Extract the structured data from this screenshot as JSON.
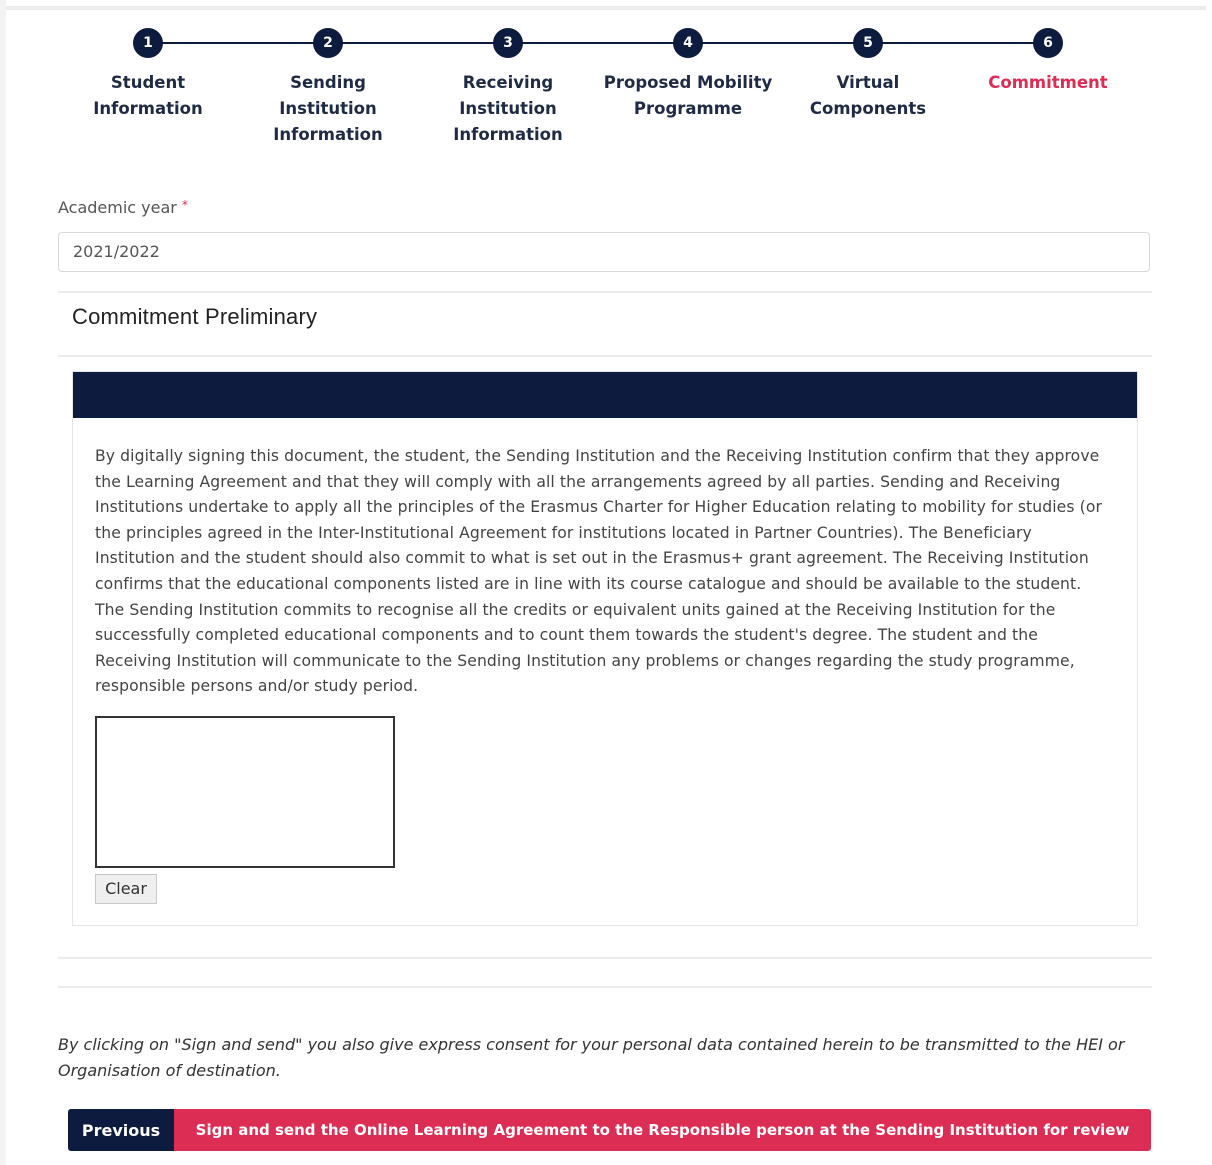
{
  "stepper": {
    "steps": [
      {
        "number": "1",
        "label": "Student Information"
      },
      {
        "number": "2",
        "label": "Sending Institution Information"
      },
      {
        "number": "3",
        "label": "Receiving Institution Information"
      },
      {
        "number": "4",
        "label": "Proposed Mobility Programme"
      },
      {
        "number": "5",
        "label": "Virtual Components"
      },
      {
        "number": "6",
        "label": "Commitment"
      }
    ],
    "active_step": 6
  },
  "academic_year": {
    "label": "Academic year",
    "required_mark": "*",
    "value": "2021/2022"
  },
  "section": {
    "title": "Commitment Preliminary"
  },
  "commitment": {
    "text": "By digitally signing this document, the student, the Sending Institution and the Receiving Institution confirm that they approve the Learning Agreement and that they will comply with all the arrangements agreed by all parties. Sending and Receiving Institutions undertake to apply all the principles of the Erasmus Charter for Higher Education relating to mobility for studies (or the principles agreed in the Inter-Institutional Agreement for institutions located in Partner Countries). The Beneficiary Institution and the student should also commit to what is set out in the Erasmus+ grant agreement. The Receiving Institution confirms that the educational components listed are in line with its course catalogue and should be available to the student. The Sending Institution commits to recognise all the credits or equivalent units gained at the Receiving Institution for the successfully completed educational components and to count them towards the student's degree. The student and the Receiving Institution will communicate to the Sending Institution any problems or changes regarding the study programme, responsible persons and/or study period.",
    "clear_label": "Clear"
  },
  "consent_text": "By clicking on \"Sign and send\" you also give express consent for your personal data contained herein to be transmitted to the HEI or Organisation of destination.",
  "actions": {
    "previous_label": "Previous",
    "sign_label": "Sign and send the Online Learning Agreement to the Responsible person at the Sending Institution for review"
  },
  "colors": {
    "navy": "#0d1b3e",
    "accent": "#dc2d55"
  }
}
